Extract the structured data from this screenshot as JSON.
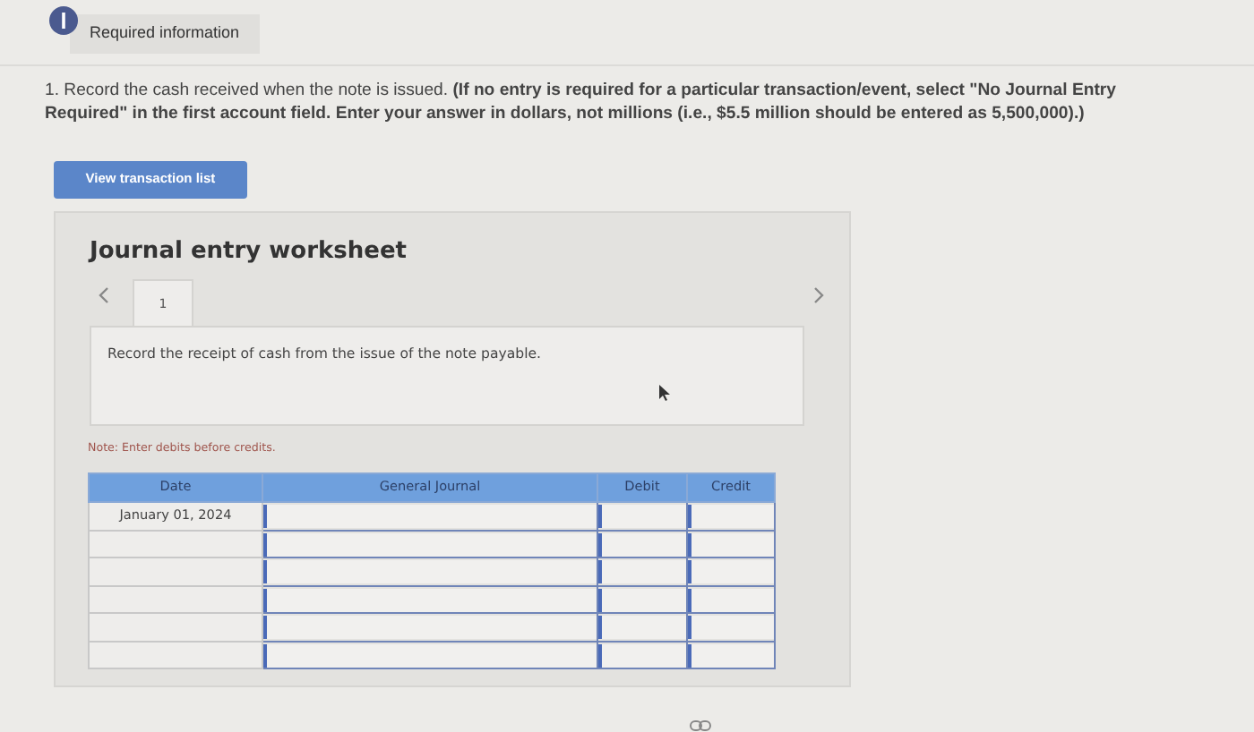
{
  "header_tab": {
    "label": "Required information"
  },
  "question": {
    "text": "1. Record the cash received when the note is issued. **(If no entry is required for a particular transaction/event, select \"No Journal Entry Required\" in the first account field. Enter your answer in dollars, not millions (i.e., $5.5 million should be entered as 5,500,000).)**"
  },
  "view_button": {
    "label": "View transaction list"
  },
  "worksheet": {
    "title": "Journal entry worksheet",
    "tabs": [
      {
        "label": "1",
        "selected": true
      }
    ],
    "instruction": "Record the receipt of cash from the issue of the note payable.",
    "note": "Note: Enter debits before credits.",
    "table": {
      "columns": [
        "Date",
        "General Journal",
        "Debit",
        "Credit"
      ],
      "rows": [
        {
          "date": "January 01, 2024"
        },
        {},
        {},
        {},
        {},
        {}
      ]
    }
  }
}
